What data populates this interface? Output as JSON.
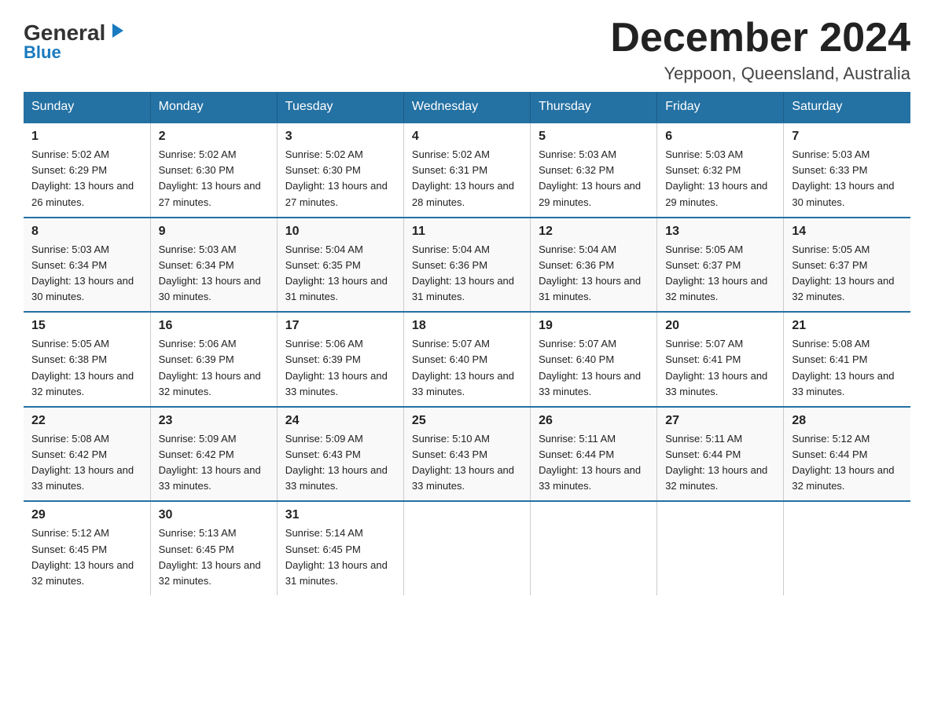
{
  "logo": {
    "general": "General",
    "blue": "Blue"
  },
  "title": "December 2024",
  "subtitle": "Yeppoon, Queensland, Australia",
  "days_of_week": [
    "Sunday",
    "Monday",
    "Tuesday",
    "Wednesday",
    "Thursday",
    "Friday",
    "Saturday"
  ],
  "weeks": [
    [
      {
        "num": "1",
        "sunrise": "5:02 AM",
        "sunset": "6:29 PM",
        "daylight": "13 hours and 26 minutes."
      },
      {
        "num": "2",
        "sunrise": "5:02 AM",
        "sunset": "6:30 PM",
        "daylight": "13 hours and 27 minutes."
      },
      {
        "num": "3",
        "sunrise": "5:02 AM",
        "sunset": "6:30 PM",
        "daylight": "13 hours and 27 minutes."
      },
      {
        "num": "4",
        "sunrise": "5:02 AM",
        "sunset": "6:31 PM",
        "daylight": "13 hours and 28 minutes."
      },
      {
        "num": "5",
        "sunrise": "5:03 AM",
        "sunset": "6:32 PM",
        "daylight": "13 hours and 29 minutes."
      },
      {
        "num": "6",
        "sunrise": "5:03 AM",
        "sunset": "6:32 PM",
        "daylight": "13 hours and 29 minutes."
      },
      {
        "num": "7",
        "sunrise": "5:03 AM",
        "sunset": "6:33 PM",
        "daylight": "13 hours and 30 minutes."
      }
    ],
    [
      {
        "num": "8",
        "sunrise": "5:03 AM",
        "sunset": "6:34 PM",
        "daylight": "13 hours and 30 minutes."
      },
      {
        "num": "9",
        "sunrise": "5:03 AM",
        "sunset": "6:34 PM",
        "daylight": "13 hours and 30 minutes."
      },
      {
        "num": "10",
        "sunrise": "5:04 AM",
        "sunset": "6:35 PM",
        "daylight": "13 hours and 31 minutes."
      },
      {
        "num": "11",
        "sunrise": "5:04 AM",
        "sunset": "6:36 PM",
        "daylight": "13 hours and 31 minutes."
      },
      {
        "num": "12",
        "sunrise": "5:04 AM",
        "sunset": "6:36 PM",
        "daylight": "13 hours and 31 minutes."
      },
      {
        "num": "13",
        "sunrise": "5:05 AM",
        "sunset": "6:37 PM",
        "daylight": "13 hours and 32 minutes."
      },
      {
        "num": "14",
        "sunrise": "5:05 AM",
        "sunset": "6:37 PM",
        "daylight": "13 hours and 32 minutes."
      }
    ],
    [
      {
        "num": "15",
        "sunrise": "5:05 AM",
        "sunset": "6:38 PM",
        "daylight": "13 hours and 32 minutes."
      },
      {
        "num": "16",
        "sunrise": "5:06 AM",
        "sunset": "6:39 PM",
        "daylight": "13 hours and 32 minutes."
      },
      {
        "num": "17",
        "sunrise": "5:06 AM",
        "sunset": "6:39 PM",
        "daylight": "13 hours and 33 minutes."
      },
      {
        "num": "18",
        "sunrise": "5:07 AM",
        "sunset": "6:40 PM",
        "daylight": "13 hours and 33 minutes."
      },
      {
        "num": "19",
        "sunrise": "5:07 AM",
        "sunset": "6:40 PM",
        "daylight": "13 hours and 33 minutes."
      },
      {
        "num": "20",
        "sunrise": "5:07 AM",
        "sunset": "6:41 PM",
        "daylight": "13 hours and 33 minutes."
      },
      {
        "num": "21",
        "sunrise": "5:08 AM",
        "sunset": "6:41 PM",
        "daylight": "13 hours and 33 minutes."
      }
    ],
    [
      {
        "num": "22",
        "sunrise": "5:08 AM",
        "sunset": "6:42 PM",
        "daylight": "13 hours and 33 minutes."
      },
      {
        "num": "23",
        "sunrise": "5:09 AM",
        "sunset": "6:42 PM",
        "daylight": "13 hours and 33 minutes."
      },
      {
        "num": "24",
        "sunrise": "5:09 AM",
        "sunset": "6:43 PM",
        "daylight": "13 hours and 33 minutes."
      },
      {
        "num": "25",
        "sunrise": "5:10 AM",
        "sunset": "6:43 PM",
        "daylight": "13 hours and 33 minutes."
      },
      {
        "num": "26",
        "sunrise": "5:11 AM",
        "sunset": "6:44 PM",
        "daylight": "13 hours and 33 minutes."
      },
      {
        "num": "27",
        "sunrise": "5:11 AM",
        "sunset": "6:44 PM",
        "daylight": "13 hours and 32 minutes."
      },
      {
        "num": "28",
        "sunrise": "5:12 AM",
        "sunset": "6:44 PM",
        "daylight": "13 hours and 32 minutes."
      }
    ],
    [
      {
        "num": "29",
        "sunrise": "5:12 AM",
        "sunset": "6:45 PM",
        "daylight": "13 hours and 32 minutes."
      },
      {
        "num": "30",
        "sunrise": "5:13 AM",
        "sunset": "6:45 PM",
        "daylight": "13 hours and 32 minutes."
      },
      {
        "num": "31",
        "sunrise": "5:14 AM",
        "sunset": "6:45 PM",
        "daylight": "13 hours and 31 minutes."
      },
      null,
      null,
      null,
      null
    ]
  ]
}
